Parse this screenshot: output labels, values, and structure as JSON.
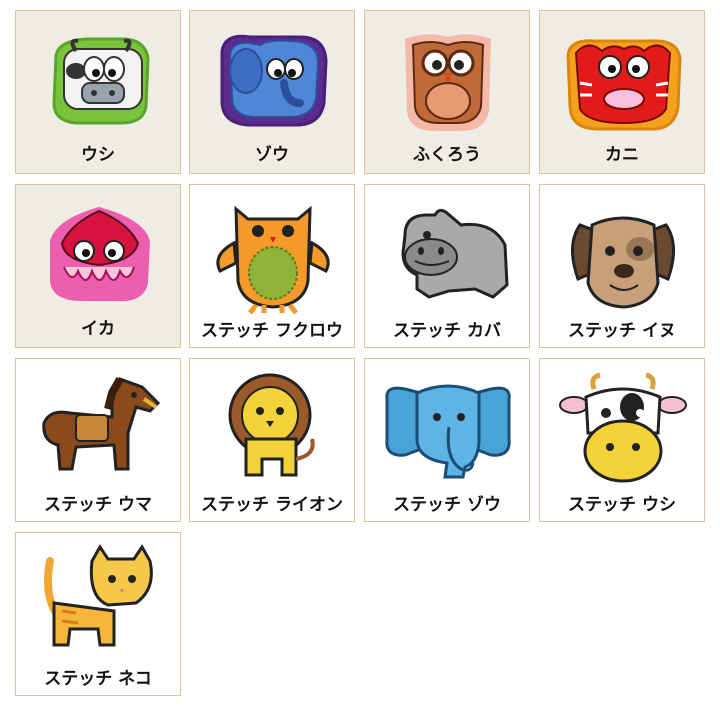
{
  "items": [
    {
      "label": "ウシ",
      "icon": "cow-patch-icon"
    },
    {
      "label": "ゾウ",
      "icon": "elephant-patch-icon"
    },
    {
      "label": "ふくろう",
      "icon": "owl-patch-icon"
    },
    {
      "label": "カニ",
      "icon": "crab-patch-icon"
    },
    {
      "label": "イカ",
      "icon": "squid-patch-icon"
    },
    {
      "label": "ステッチ フクロウ",
      "icon": "stitch-owl-patch-icon"
    },
    {
      "label": "ステッチ カバ",
      "icon": "stitch-hippo-patch-icon"
    },
    {
      "label": "ステッチ イヌ",
      "icon": "stitch-dog-patch-icon"
    },
    {
      "label": "ステッチ ウマ",
      "icon": "stitch-horse-patch-icon"
    },
    {
      "label": "ステッチ ライオン",
      "icon": "stitch-lion-patch-icon"
    },
    {
      "label": "ステッチ ゾウ",
      "icon": "stitch-elephant-patch-icon"
    },
    {
      "label": "ステッチ ウシ",
      "icon": "stitch-cow-patch-icon"
    },
    {
      "label": "ステッチ ネコ",
      "icon": "stitch-cat-patch-icon"
    }
  ]
}
